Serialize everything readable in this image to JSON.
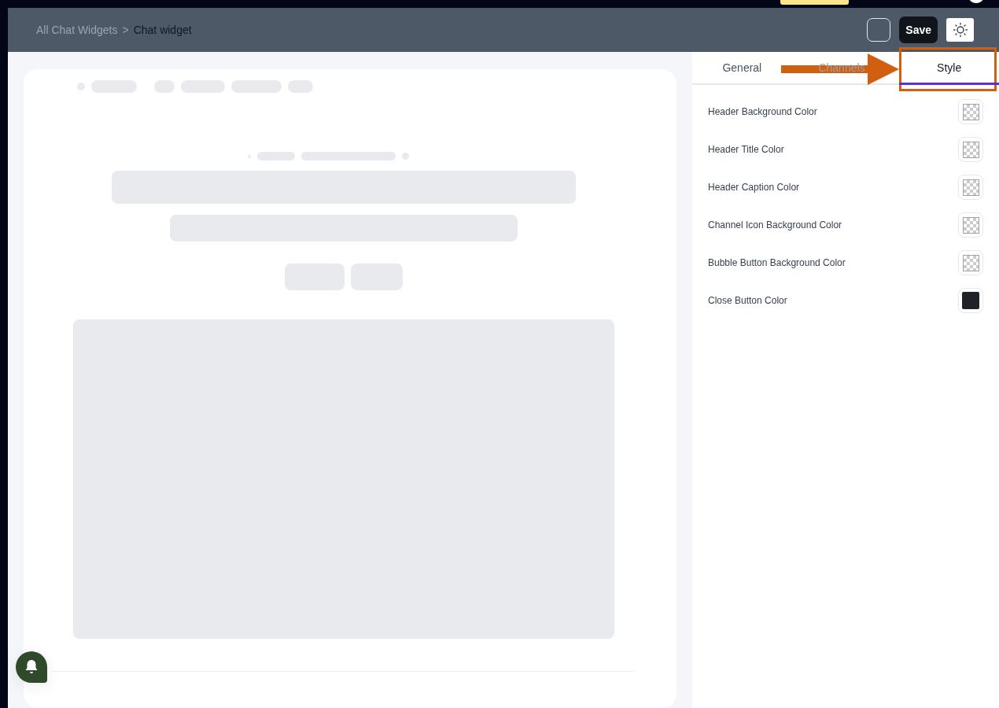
{
  "breadcrumb": {
    "parent": "All Chat Widgets",
    "separator": ">",
    "current": "Chat widget"
  },
  "header": {
    "save": "Save"
  },
  "tabs": [
    {
      "label": "General",
      "selected": false
    },
    {
      "label": "Channels",
      "selected": false
    },
    {
      "label": "Style",
      "selected": true
    }
  ],
  "style_settings": [
    {
      "label": "Header Background Color",
      "kind": "transparent"
    },
    {
      "label": "Header Title Color",
      "kind": "transparent"
    },
    {
      "label": "Header Caption Color",
      "kind": "transparent"
    },
    {
      "label": "Channel Icon Background Color",
      "kind": "transparent"
    },
    {
      "label": "Bubble Button Background Color",
      "kind": "transparent"
    },
    {
      "label": "Close Button Color",
      "kind": "solid",
      "color": "#1f2229"
    }
  ]
}
